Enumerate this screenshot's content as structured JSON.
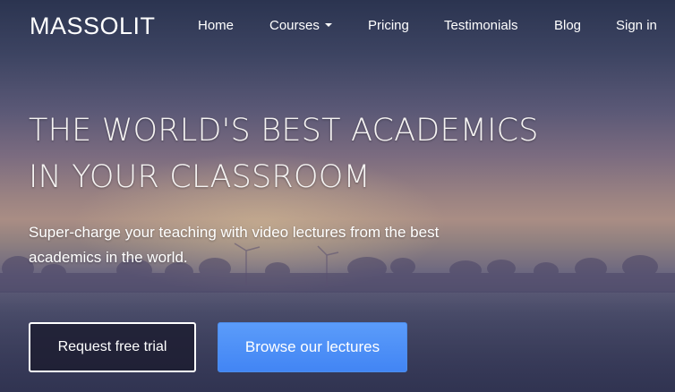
{
  "brand": "MASSOLIT",
  "nav": {
    "home": "Home",
    "courses": "Courses",
    "pricing": "Pricing",
    "testimonials": "Testimonials",
    "blog": "Blog",
    "signin": "Sign in"
  },
  "hero": {
    "headline_line1": "THE WORLD'S BEST ACADEMICS",
    "headline_line2": "IN YOUR CLASSROOM",
    "subhead": "Super-charge your teaching with video lectures from the best academics in the world.",
    "cta_trial": "Request free trial",
    "cta_browse": "Browse our lectures"
  },
  "colors": {
    "primary_button": "#4285f4",
    "outline_button_bg": "#1c1c30",
    "text": "#ffffff"
  },
  "icons": {
    "courses_dropdown": "caret-down-icon"
  }
}
